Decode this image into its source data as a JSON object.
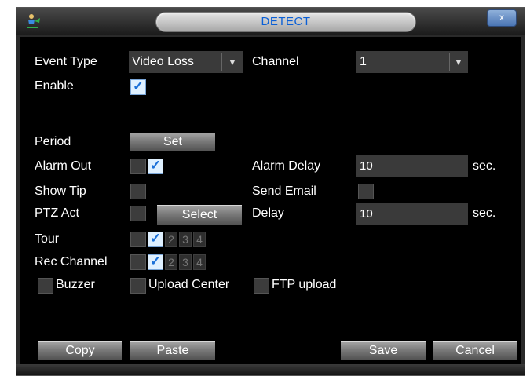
{
  "window": {
    "title": "DETECT",
    "close_glyph": "x"
  },
  "form": {
    "event_type_label": "Event Type",
    "event_type_value": "Video Loss",
    "channel_label": "Channel",
    "channel_value": "1",
    "enable_label": "Enable",
    "enable_checked": true,
    "period_label": "Period",
    "period_button": "Set",
    "alarm_out_label": "Alarm Out",
    "alarm_delay_label": "Alarm Delay",
    "alarm_delay_value": "10",
    "alarm_delay_unit": "sec.",
    "show_tip_label": "Show Tip",
    "send_email_label": "Send Email",
    "ptz_act_label": "PTZ Act",
    "ptz_select_button": "Select",
    "delay_label": "Delay",
    "delay_value": "10",
    "delay_unit": "sec.",
    "tour_label": "Tour",
    "tour_numbers": [
      "2",
      "3",
      "4"
    ],
    "rec_channel_label": "Rec Channel",
    "rec_channel_numbers": [
      "2",
      "3",
      "4"
    ],
    "buzzer_label": "Buzzer",
    "upload_center_label": "Upload Center",
    "ftp_upload_label": "FTP upload"
  },
  "buttons": {
    "copy": "Copy",
    "paste": "Paste",
    "save": "Save",
    "cancel": "Cancel"
  },
  "icons": {
    "logo": "person-arrow-icon",
    "close": "close-icon",
    "dropdown": "triangle-down-icon",
    "check": "checkmark-icon"
  },
  "colors": {
    "title_text": "#0a5fd6",
    "panel_bg": "#000000",
    "check_blue": "#1b70d8"
  }
}
